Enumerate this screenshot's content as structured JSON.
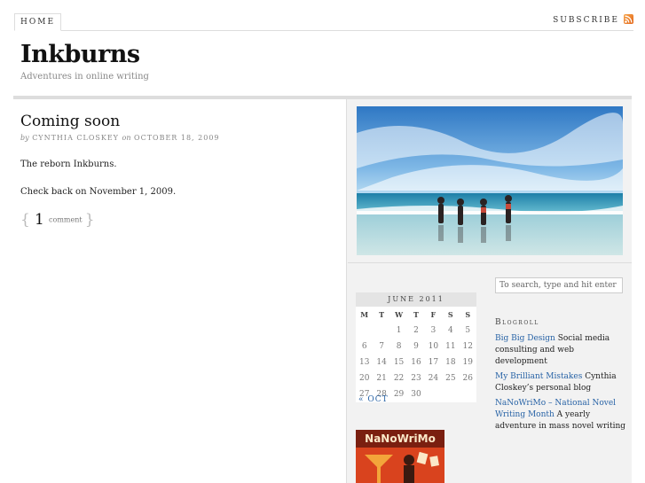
{
  "nav": {
    "home_label": "HOME",
    "subscribe_label": "SUBSCRIBE"
  },
  "site": {
    "title": "Inkburns",
    "tagline": "Adventures in online writing"
  },
  "post": {
    "title": "Coming soon",
    "byline_by": "by",
    "author": "Cynthia Closkey",
    "byline_on": "on",
    "date": "OCTOBER 18, 2009",
    "paragraphs": [
      "The reborn Inkburns.",
      "Check back on November 1, 2009."
    ],
    "comment_count": "1",
    "comment_word": "comment"
  },
  "search": {
    "placeholder": "To search, type and hit enter"
  },
  "calendar": {
    "caption": "JUNE 2011",
    "weekdays": [
      "M",
      "T",
      "W",
      "T",
      "F",
      "S",
      "S"
    ],
    "rows": [
      [
        "",
        "",
        "1",
        "2",
        "3",
        "4",
        "5"
      ],
      [
        "6",
        "7",
        "8",
        "9",
        "10",
        "11",
        "12"
      ],
      [
        "13",
        "14",
        "15",
        "16",
        "17",
        "18",
        "19"
      ],
      [
        "20",
        "21",
        "22",
        "23",
        "24",
        "25",
        "26"
      ],
      [
        "27",
        "28",
        "29",
        "30",
        "",
        "",
        ""
      ]
    ],
    "prev_label": "« OCT"
  },
  "blogroll": {
    "heading": "Blogroll",
    "items": [
      {
        "link": "Big Big Design",
        "desc": " Social media consulting and web development"
      },
      {
        "link": "My Brilliant Mistakes",
        "desc": " Cynthia Closkey’s personal blog"
      },
      {
        "link": "NaNoWriMo – National Novel Writing Month",
        "desc": " A yearly adventure in mass novel writing"
      }
    ]
  },
  "badge": {
    "text": "NaNoWriMo"
  },
  "colors": {
    "link": "#2863a6",
    "rss": "#e2661b",
    "badge": "#d9431e"
  }
}
